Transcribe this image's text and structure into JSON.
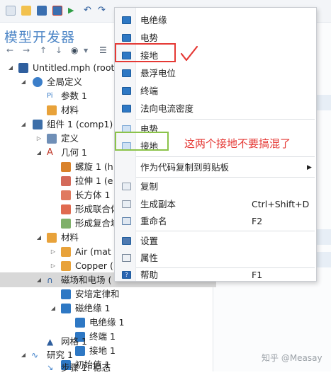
{
  "builder": {
    "title": "模型开发器"
  },
  "tree": {
    "items": [
      {
        "label": "Untitled.mph (root)"
      },
      {
        "label": "全局定义"
      },
      {
        "label": "参数 1"
      },
      {
        "label": "材料"
      },
      {
        "label": "组件 1 (comp1)"
      },
      {
        "label": "定义"
      },
      {
        "label": "几何 1"
      },
      {
        "label": "螺旋 1 (h"
      },
      {
        "label": "拉伸 1 (e"
      },
      {
        "label": "长方体 1"
      },
      {
        "label": "形成联合体"
      },
      {
        "label": "形成复合域"
      },
      {
        "label": "材料"
      },
      {
        "label": "Air (mat"
      },
      {
        "label": "Copper ("
      },
      {
        "label": "磁场和电场 ("
      },
      {
        "label": "安培定律和"
      },
      {
        "label": "磁绝缘 1"
      },
      {
        "label": "电绝缘 1"
      },
      {
        "label": "终端 1"
      },
      {
        "label": "接地 1"
      },
      {
        "label": "初始值 1"
      },
      {
        "label": "网格 1"
      },
      {
        "label": "研究 1"
      },
      {
        "label": "步骤 1: 稳态"
      }
    ]
  },
  "context_menu": {
    "items": [
      {
        "label": "电绝缘"
      },
      {
        "label": "电势"
      },
      {
        "label": "接地"
      },
      {
        "label": "悬浮电位"
      },
      {
        "label": "终端"
      },
      {
        "label": "法向电流密度"
      },
      {
        "label": "电势"
      },
      {
        "label": "接地"
      },
      {
        "label": "作为代码复制到剪贴板"
      },
      {
        "label": "复制"
      },
      {
        "label": "生成副本",
        "shortcut": "Ctrl+Shift+D"
      },
      {
        "label": "重命名",
        "shortcut": "F2"
      },
      {
        "label": "设置"
      },
      {
        "label": "属性"
      },
      {
        "label": "帮助",
        "shortcut": "F1"
      }
    ]
  },
  "annotation": {
    "text": "这两个接地不要搞混了"
  },
  "watermark": "知乎 @Measay",
  "colors": {
    "accent": "#4f87c7",
    "menu_icon": "#2e78c4",
    "annotation_red": "#e53935",
    "annotation_green": "#8bc34a",
    "selected_row": "#d8d8d8"
  }
}
